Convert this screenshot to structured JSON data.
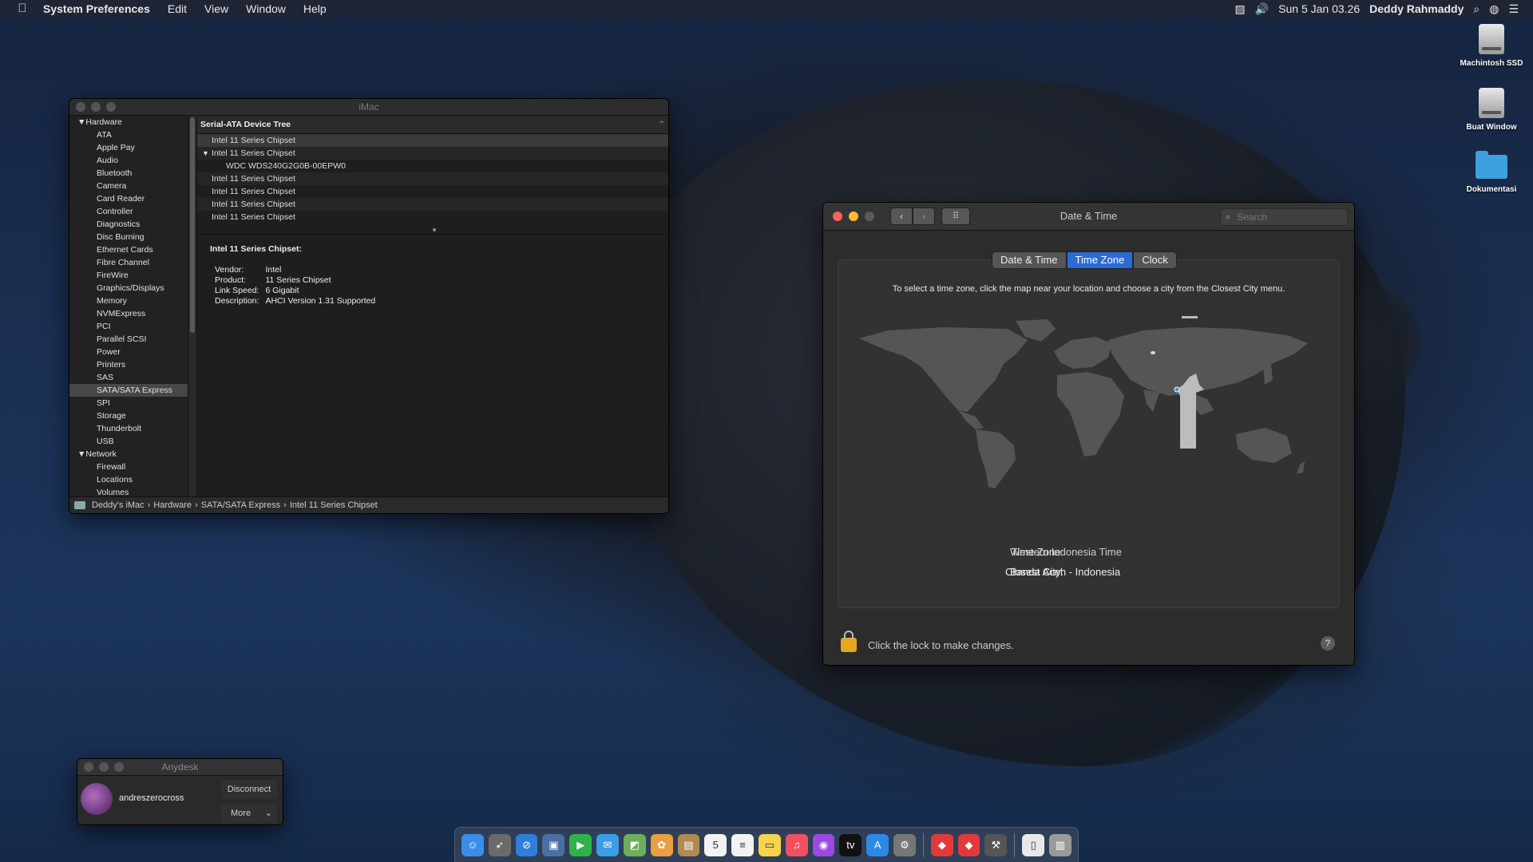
{
  "menubar": {
    "app_name": "System Preferences",
    "menus": [
      "Edit",
      "View",
      "Window",
      "Help"
    ],
    "clock": "Sun 5 Jan  03.26",
    "user": "Deddy Rahmaddy"
  },
  "desktop": {
    "icons": [
      {
        "label": "Machintosh SSD",
        "kind": "disk"
      },
      {
        "label": "Buat Window",
        "kind": "disk"
      },
      {
        "label": "Dokumentasi",
        "kind": "folder"
      }
    ]
  },
  "sysinfo": {
    "title": "iMac",
    "sidebar": {
      "hardware_label": "Hardware",
      "hardware_items": [
        "ATA",
        "Apple Pay",
        "Audio",
        "Bluetooth",
        "Camera",
        "Card Reader",
        "Controller",
        "Diagnostics",
        "Disc Burning",
        "Ethernet Cards",
        "Fibre Channel",
        "FireWire",
        "Graphics/Displays",
        "Memory",
        "NVMExpress",
        "PCI",
        "Parallel SCSI",
        "Power",
        "Printers",
        "SAS",
        "SATA/SATA Express",
        "SPI",
        "Storage",
        "Thunderbolt",
        "USB"
      ],
      "selected": "SATA/SATA Express",
      "network_label": "Network",
      "network_items": [
        "Firewall",
        "Locations",
        "Volumes"
      ]
    },
    "tree_header": "Serial-ATA Device Tree",
    "tree_rows": [
      {
        "text": "Intel 11 Series Chipset",
        "indent": 1
      },
      {
        "text": "Intel 11 Series Chipset",
        "indent": 1,
        "expanded": true
      },
      {
        "text": "WDC WDS240G2G0B-00EPW0",
        "indent": 2
      },
      {
        "text": "Intel 11 Series Chipset",
        "indent": 1
      },
      {
        "text": "Intel 11 Series Chipset",
        "indent": 1
      },
      {
        "text": "Intel 11 Series Chipset",
        "indent": 1
      },
      {
        "text": "Intel 11 Series Chipset",
        "indent": 1
      }
    ],
    "detail": {
      "title": "Intel 11 Series Chipset:",
      "fields": [
        {
          "key": "Vendor:",
          "value": "Intel"
        },
        {
          "key": "Product:",
          "value": "11 Series Chipset"
        },
        {
          "key": "Link Speed:",
          "value": "6 Gigabit"
        },
        {
          "key": "Description:",
          "value": "AHCI Version 1.31 Supported"
        }
      ]
    },
    "path": [
      "Deddy's iMac",
      "Hardware",
      "SATA/SATA Express",
      "Intel 11 Series Chipset"
    ]
  },
  "datetime": {
    "title": "Date & Time",
    "search_placeholder": "Search",
    "tabs": [
      "Date & Time",
      "Time Zone",
      "Clock"
    ],
    "active_tab": "Time Zone",
    "instructions": "To select a time zone, click the map near your location and choose a city from the Closest City menu.",
    "time_zone_label": "Time Zone:",
    "time_zone_value": "Western Indonesia Time",
    "closest_city_label": "Closest City:",
    "closest_city_value": "Banda Aceh - Indonesia",
    "lock_text": "Click the lock to make changes.",
    "help": "?"
  },
  "anydesk": {
    "title": "Anydesk",
    "user": "andreszerocross",
    "disconnect": "Disconnect",
    "more": "More"
  },
  "dock": {
    "items": [
      {
        "name": "finder-icon",
        "glyph": "☺",
        "color": "#3a8ee6"
      },
      {
        "name": "launchpad-icon",
        "glyph": "➶",
        "color": "#6a6a6a"
      },
      {
        "name": "safari-icon",
        "glyph": "⊘",
        "color": "#2f7fd9"
      },
      {
        "name": "preview-icon",
        "glyph": "▣",
        "color": "#4a6fa5"
      },
      {
        "name": "facetime-icon",
        "glyph": "▶",
        "color": "#2fb24a"
      },
      {
        "name": "messages-icon",
        "glyph": "✉",
        "color": "#3a9de6"
      },
      {
        "name": "maps-icon",
        "glyph": "◩",
        "color": "#6cae5a"
      },
      {
        "name": "photos-icon",
        "glyph": "✿",
        "color": "#e8a040"
      },
      {
        "name": "contacts-icon",
        "glyph": "▤",
        "color": "#b08a50"
      },
      {
        "name": "calendar-icon",
        "glyph": "5",
        "color": "#f2f2f2"
      },
      {
        "name": "reminders-icon",
        "glyph": "≡",
        "color": "#f2f2f2"
      },
      {
        "name": "notes-icon",
        "glyph": "▭",
        "color": "#f5d34a"
      },
      {
        "name": "music-icon",
        "glyph": "♫",
        "color": "#f05060"
      },
      {
        "name": "podcasts-icon",
        "glyph": "◉",
        "color": "#9a4ae0"
      },
      {
        "name": "tv-icon",
        "glyph": "tv",
        "color": "#111111"
      },
      {
        "name": "app-store-icon",
        "glyph": "A",
        "color": "#2a8ae6"
      },
      {
        "name": "system-preferences-icon",
        "glyph": "⚙",
        "color": "#777777"
      },
      {
        "name": "anydesk-icon",
        "glyph": "◆",
        "color": "#e23a3a"
      },
      {
        "name": "anydesk-alt-icon",
        "glyph": "◆",
        "color": "#e23a3a"
      },
      {
        "name": "xcode-icon",
        "glyph": "⚒",
        "color": "#555555"
      },
      {
        "name": "document-icon",
        "glyph": "▯",
        "color": "#e8e8e8"
      },
      {
        "name": "trash-icon",
        "glyph": "▥",
        "color": "#9a9a9a"
      }
    ]
  }
}
